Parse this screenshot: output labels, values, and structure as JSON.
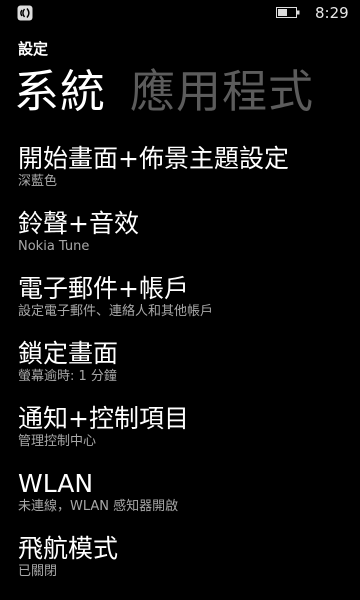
{
  "status_bar": {
    "time": "8:29",
    "icons": [
      "nfc-icon",
      "battery-icon"
    ]
  },
  "app": {
    "title": "設定"
  },
  "pivot": {
    "tabs": [
      {
        "label": "系統",
        "active": true
      },
      {
        "label": "應用程式",
        "active": false
      }
    ]
  },
  "settings": {
    "items": [
      {
        "title": "開始畫面+佈景主題設定",
        "subtitle": "深藍色"
      },
      {
        "title": "鈴聲+音效",
        "subtitle": "Nokia Tune"
      },
      {
        "title": "電子郵件+帳戶",
        "subtitle": "設定電子郵件、連絡人和其他帳戶"
      },
      {
        "title": "鎖定畫面",
        "subtitle": "螢幕逾時: 1 分鐘"
      },
      {
        "title": "通知+控制項目",
        "subtitle": "管理控制中心"
      },
      {
        "title": "WLAN",
        "subtitle": "未連線，WLAN 感知器開啟"
      },
      {
        "title": "飛航模式",
        "subtitle": "已關閉"
      }
    ]
  },
  "colors": {
    "background": "#000000",
    "text_primary": "#ffffff",
    "text_secondary": "#a8a8a8",
    "pivot_inactive": "#5c5c5c"
  }
}
